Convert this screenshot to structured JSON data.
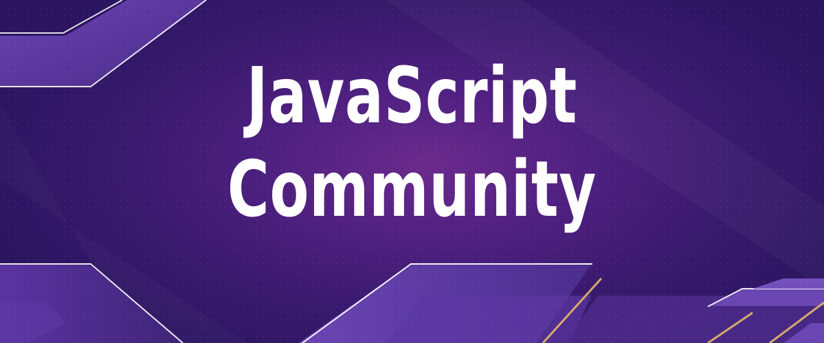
{
  "banner": {
    "title_line1": "JavaScript",
    "title_line2": "Community"
  },
  "colors": {
    "background": "#4e2080",
    "shape_fill": "#5a2f96",
    "shape_highlight": "#ffffff",
    "accent_gold": "#d9a96a",
    "text": "#ffffff"
  }
}
